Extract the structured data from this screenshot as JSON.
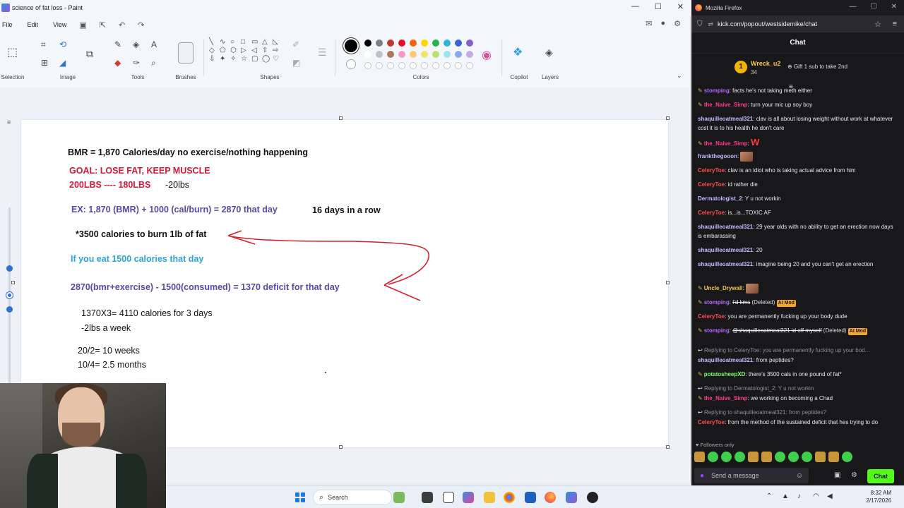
{
  "paint": {
    "title": "science of fat loss - Paint",
    "menu": [
      "File",
      "Edit",
      "View"
    ],
    "ribbon_groups": {
      "selection": "Selection",
      "image": "Image",
      "tools": "Tools",
      "brushes": "Brushes",
      "shapes": "Shapes",
      "colors": "Colors",
      "copilot": "Copilot",
      "layers": "Layers"
    },
    "colors": {
      "row1": [
        "#000000",
        "#7f7f7f",
        "#c0392b",
        "#e81123",
        "#f7630c",
        "#ffd700",
        "#25b34a",
        "#2fb5d8",
        "#3a63d1",
        "#8b5cc9"
      ],
      "row2": [
        "#ffffff",
        "#c3c3c3",
        "#a8795c",
        "#f79bc5",
        "#ffc97a",
        "#f2e46b",
        "#b5e36b",
        "#9fe3f0",
        "#8aa9e8",
        "#c9a8e6"
      ]
    },
    "canvas_text": {
      "bmr": "BMR = 1,870 Calories/day no exercise/nothing happening",
      "goal": "GOAL: LOSE FAT, KEEP MUSCLE",
      "weights": "200LBS ---- 180LBS",
      "minus20": "-20lbs",
      "ex": "EX: 1,870 (BMR) + 1000 (cal/burn) = 2870 that day",
      "days_row": "16 days in a row",
      "cal3500": "*3500 calories to burn 1lb of fat",
      "if_eat": "If you eat 1500 calories that day",
      "deficit": "2870(bmr+exercise) - 1500(consumed) = 1370 deficit for that day",
      "x3": "1370X3= 4110 calories for 3 days",
      "week": "-2lbs a week",
      "weeks": "20/2= 10 weeks",
      "months": "10/4= 2.5 months"
    }
  },
  "taskbar": {
    "search_label": "Search",
    "time": "8:32 AM",
    "date": "2/17/2026"
  },
  "firefox": {
    "title": "Mozilla Firefox",
    "url": "kick.com/popout/westsidemike/chat",
    "chat_title": "Chat",
    "pinned": {
      "rank": "1",
      "user": "Wreck_u2",
      "count": "34",
      "gift_text": "Gift 1 sub to take 2nd"
    },
    "messages": [
      {
        "user": "stomping",
        "color": "#b667ff",
        "text": "facts he's not taking meth either",
        "pencil": true
      },
      {
        "user": "the_Naive_Simp",
        "color": "#ff3b8b",
        "text": "turn your mic up soy boy",
        "pencil": true
      },
      {
        "user": "shaquilleoatmeal321",
        "color": "#c9b6ff",
        "text": "clav is all about losing weight without work at whatever cost it is to his health he don't care"
      },
      {
        "user": "the_Naive_Simp",
        "color": "#ff3b8b",
        "text": "W",
        "pencil": true
      },
      {
        "user": "frankthegooon",
        "color": "#c9b6ff",
        "text": ""
      },
      {
        "user": "CeleryToe",
        "color": "#ff4f4f",
        "text": "clav is an idiot who is taking actual advice from him"
      },
      {
        "user": "CeleryToe",
        "color": "#ff4f4f",
        "text": "id rather die"
      },
      {
        "user": "Dermatologist_2",
        "color": "#c9b6ff",
        "text": "Y u not workin"
      },
      {
        "user": "CeleryToe",
        "color": "#ff4f4f",
        "text": "is...is...TOXIC AF"
      },
      {
        "user": "shaquilleoatmeal321",
        "color": "#c9b6ff",
        "text": "29 year olds with no ability to get an erection now days is embarassing"
      },
      {
        "user": "shaquilleoatmeal321",
        "color": "#c9b6ff",
        "text": "20"
      },
      {
        "user": "shaquilleoatmeal321",
        "color": "#c9b6ff",
        "text": "imagine being 20 and you can't get an erection"
      },
      {
        "user": "Uncle_Drywall",
        "color": "#f5c84b",
        "text": "",
        "pencil": true
      },
      {
        "user": "stomping",
        "color": "#b667ff",
        "text": "I'd kms",
        "pencil": true,
        "deleted": "(Deleted)",
        "badge": "AI Mod"
      },
      {
        "user": "CeleryToe",
        "color": "#ff4f4f",
        "text": "you are permanently fucking up your body dude"
      },
      {
        "user": "stomping",
        "color": "#b667ff",
        "text": "@shaquilleoatmeal321 id off myself",
        "pencil": true,
        "deleted": "(Deleted)",
        "badge": "AI Mod"
      },
      {
        "reply": "Replying to CeleryToe: you are permanently fucking up your bod..."
      },
      {
        "user": "shaquilleoatmeal321",
        "color": "#c9b6ff",
        "text": "from peptides?"
      },
      {
        "user": "potatosheepXD",
        "color": "#7cff6b",
        "text": "there's 3500 cals in one pound of fat*",
        "pencil": true
      },
      {
        "reply": "Replying to Dermatologist_2: Y u not workin"
      },
      {
        "user": "the_Naive_Simp",
        "color": "#ff3b8b",
        "text": "we working on becoming a Chad",
        "pencil": true
      },
      {
        "reply": "Replying to shaquilleoatmeal321: from peptides?"
      },
      {
        "user": "CeleryToe",
        "color": "#ff4f4f",
        "text": "from the method of the sustained deficit that hes trying to do"
      }
    ],
    "followers_only": "Followers only",
    "input_placeholder": "Send a message",
    "chat_button": "Chat"
  }
}
